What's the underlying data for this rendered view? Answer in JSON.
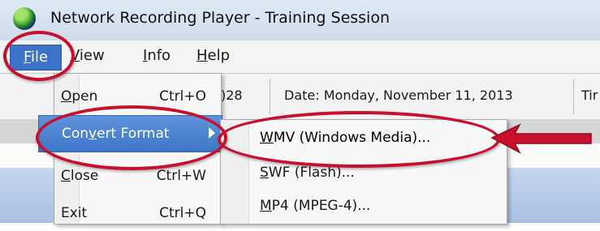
{
  "window": {
    "title": "Network Recording Player - Training Session"
  },
  "menu": [
    {
      "id": "file",
      "label": "File",
      "underline": "F",
      "rest": "ile"
    },
    {
      "id": "view",
      "label": "View",
      "underline": "V",
      "rest": "iew"
    },
    {
      "id": "info",
      "label": "Info",
      "underline": "I",
      "rest": "nfo"
    },
    {
      "id": "help",
      "label": "Help",
      "underline": "H",
      "rest": "elp"
    }
  ],
  "toolbar": {
    "id_fragment": ")28",
    "date_label": "Date: Monday, November 11, 2013",
    "time_fragment": "Tir"
  },
  "file_menu": {
    "items": [
      {
        "label": "Open",
        "u": "O",
        "rest": "pen",
        "shortcut": "Ctrl+O"
      },
      {
        "label": "Convert Format",
        "pre": "Con",
        "u": "v",
        "rest": "ert Format",
        "shortcut": ""
      },
      {
        "label": "Close",
        "u": "C",
        "rest": "lose",
        "shortcut": "Ctrl+W"
      },
      {
        "label": "Exit",
        "u": "",
        "rest": "Exit",
        "shortcut": "Ctrl+Q"
      }
    ]
  },
  "convert_submenu": {
    "items": [
      {
        "label": "WMV (Windows Media)...",
        "u": "W",
        "rest": "MV (Windows Media)..."
      },
      {
        "label": "SWF (Flash)...",
        "u": "S",
        "rest": "WF (Flash)..."
      },
      {
        "label": "MP4 (MPEG-4)...",
        "u": "M",
        "rest": "P4 (MPEG-4)..."
      }
    ]
  },
  "colors": {
    "accent": "#3c73c9",
    "callout": "#c8102e",
    "highlight": "#4a82cf"
  }
}
